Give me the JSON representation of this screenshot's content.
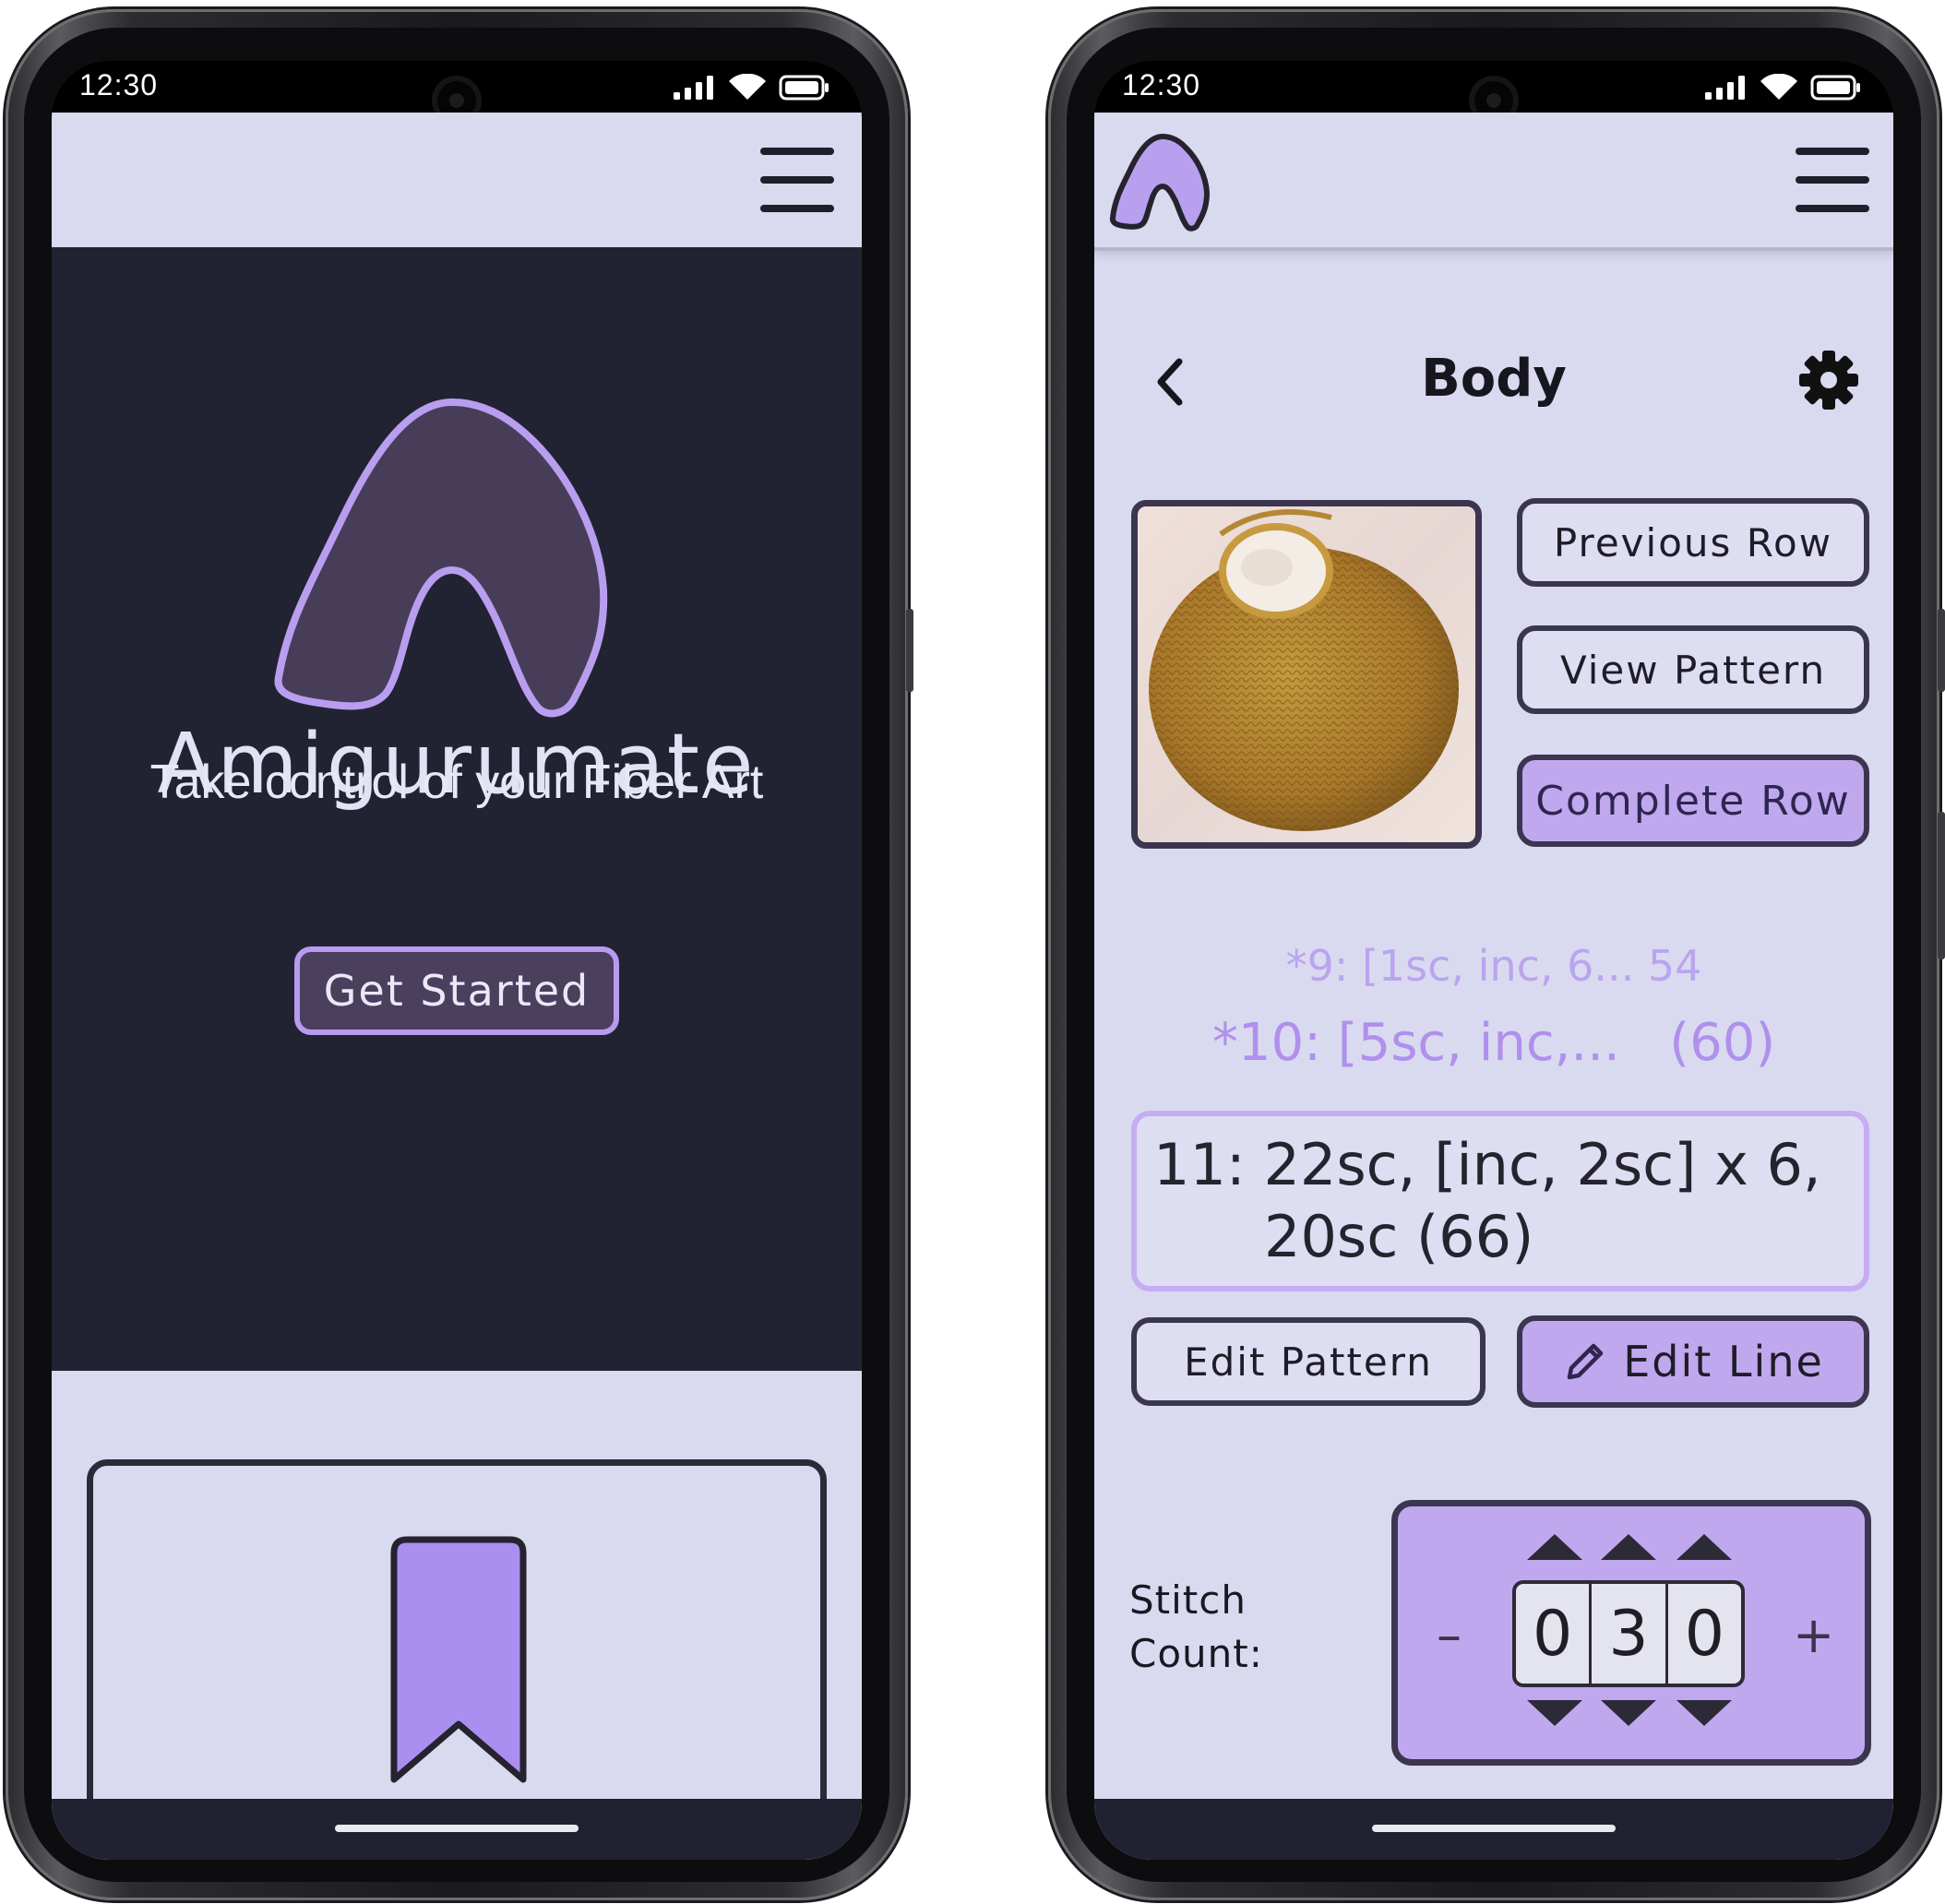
{
  "status_bar": {
    "time": "12:30"
  },
  "welcome_screen": {
    "app_name": "Amigurumate",
    "tagline": "Take control of your Fiber Art",
    "cta_label": "Get Started"
  },
  "row_screen": {
    "title": "Body",
    "buttons": {
      "previous_row": "Previous Row",
      "view_pattern": "View Pattern",
      "complete_row": "Complete Row",
      "edit_pattern": "Edit Pattern",
      "edit_line": "Edit Line"
    },
    "rows": {
      "row_9": "*9: [1sc, inc, 6... 54",
      "row_10": "*10: [5sc, inc,...   (60)",
      "current_line1": "11: 22sc, [inc, 2sc] x 6,",
      "current_line2": "20sc (66)"
    },
    "stitch_counter": {
      "label_line1": "Stitch",
      "label_line2": "Count:",
      "minus": "–",
      "plus": "+",
      "digits": [
        "0",
        "3",
        "0"
      ]
    }
  },
  "colors": {
    "accent_purple": "#c0a8ef",
    "bookmark_purple": "#aa8ef0",
    "dark_bg": "#222332",
    "light_bg": "#d9daf0",
    "outline": "#3c3550"
  },
  "icons": [
    "menu-icon",
    "logo-icon",
    "back-icon",
    "settings-gear-icon",
    "pencil-icon",
    "bookmark-icon",
    "signal-icon",
    "wifi-icon",
    "battery-icon"
  ]
}
